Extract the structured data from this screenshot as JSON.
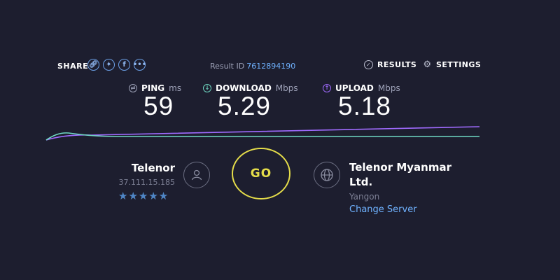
{
  "share": {
    "label": "SHARE",
    "icons": [
      "link-icon",
      "twitter-icon",
      "facebook-icon",
      "more-icon"
    ]
  },
  "result": {
    "label": "Result ID",
    "id": "7612894190"
  },
  "nav": {
    "results": "RESULTS",
    "settings": "SETTINGS"
  },
  "metrics": {
    "ping": {
      "label": "PING",
      "unit": "ms",
      "value": "59"
    },
    "download": {
      "label": "DOWNLOAD",
      "unit": "Mbps",
      "value": "5.29"
    },
    "upload": {
      "label": "UPLOAD",
      "unit": "Mbps",
      "value": "5.18"
    }
  },
  "isp": {
    "name": "Telenor",
    "ip": "37.111.15.185",
    "rating_stars": 5
  },
  "go_label": "GO",
  "server": {
    "name_line1": "Telenor Myanmar",
    "name_line2": "Ltd.",
    "city": "Yangon",
    "change": "Change Server"
  },
  "colors": {
    "background": "#1d1e2f",
    "accent_blue": "#6fb2ff",
    "go_yellow": "#e5dd4a",
    "download_line": "#6fd9c3",
    "upload_line": "#a06bff"
  }
}
